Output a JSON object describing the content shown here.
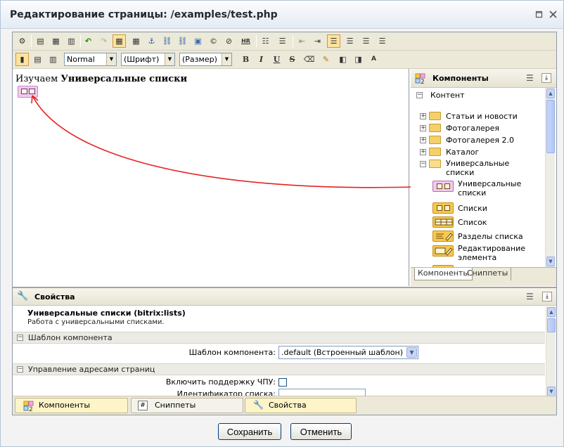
{
  "window": {
    "title": "Редактирование страницы: /examples/test.php",
    "restore_icon": "restore-icon",
    "close_icon": "close-icon"
  },
  "toolbar": {
    "style_select": "Normal",
    "font_select": "(Шрифт)",
    "size_select": "(Размер)",
    "hr_label": "HR",
    "bold_label": "B",
    "italic_label": "I",
    "underline_label": "U",
    "strike_label": "S"
  },
  "editor": {
    "content_prefix": "Изучаем",
    "content_bold": "Универсальные списки"
  },
  "components_panel": {
    "title": "Компоненты",
    "root_label": "Контент",
    "tree": [
      {
        "label": "Статьи и новости",
        "state": "collapsed"
      },
      {
        "label": "Фотогалерея",
        "state": "collapsed"
      },
      {
        "label": "Фотогалерея 2.0",
        "state": "collapsed"
      },
      {
        "label": "Каталог",
        "state": "collapsed"
      },
      {
        "label": "Универсальные",
        "label2": "списки",
        "state": "expanded"
      }
    ],
    "components": [
      {
        "label": "Универсальные",
        "label2": "списки"
      },
      {
        "label": "Списки"
      },
      {
        "label": "Список"
      },
      {
        "label": "Разделы списка"
      },
      {
        "label": "Редактирование",
        "label2": "элемента"
      }
    ],
    "tabs": [
      "Компоненты",
      "Сниппеты"
    ]
  },
  "properties": {
    "title": "Свойства",
    "component_name": "Универсальные списки (bitrix:lists)",
    "component_desc": "Работа с универсальными списками.",
    "sections": [
      {
        "label": "Шаблон компонента"
      },
      {
        "label": "Управление адресами страниц"
      }
    ],
    "template_label": "Шаблон компонента:",
    "template_value": ".default (Встроенный шаблон)",
    "sef_label": "Включить поддержку ЧПУ:",
    "list_id_label": "Идентификатор списка:"
  },
  "bottom_tabs": [
    "Компоненты",
    "Сниппеты",
    "Свойства"
  ],
  "buttons": {
    "save": "Сохранить",
    "cancel": "Отменить"
  },
  "colors": {
    "arrow": "#e82020",
    "accent": "#fde3a0"
  }
}
